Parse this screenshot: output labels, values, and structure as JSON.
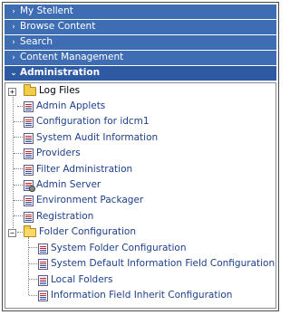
{
  "menu": [
    {
      "label": "My Stellent",
      "chevron": "›"
    },
    {
      "label": "Browse Content",
      "chevron": "›"
    },
    {
      "label": "Search",
      "chevron": "›"
    },
    {
      "label": "Content Management",
      "chevron": "›"
    },
    {
      "label": "Administration",
      "chevron": "⌄"
    }
  ],
  "tree": {
    "expander_collapsed": "+",
    "expander_expanded": "−",
    "log_files": "Log Files",
    "admin_applets": "Admin Applets",
    "configuration": "Configuration for idcm1",
    "system_audit": "System Audit Information",
    "providers": "Providers",
    "filter_admin": "Filter Administration",
    "admin_server": "Admin Server",
    "environment_packager": "Environment Packager",
    "registration": "Registration",
    "folder_configuration": "Folder Configuration",
    "folder_children": [
      "System Folder Configuration",
      "System Default Information Field Configuration",
      "Local Folders",
      "Information Field Inherit Configuration"
    ]
  },
  "colors": {
    "menu_bar": "#3f6db4",
    "menu_active": "#2e5aa3",
    "link_text": "#1d3f8a",
    "folder": "#f2cc4a"
  }
}
